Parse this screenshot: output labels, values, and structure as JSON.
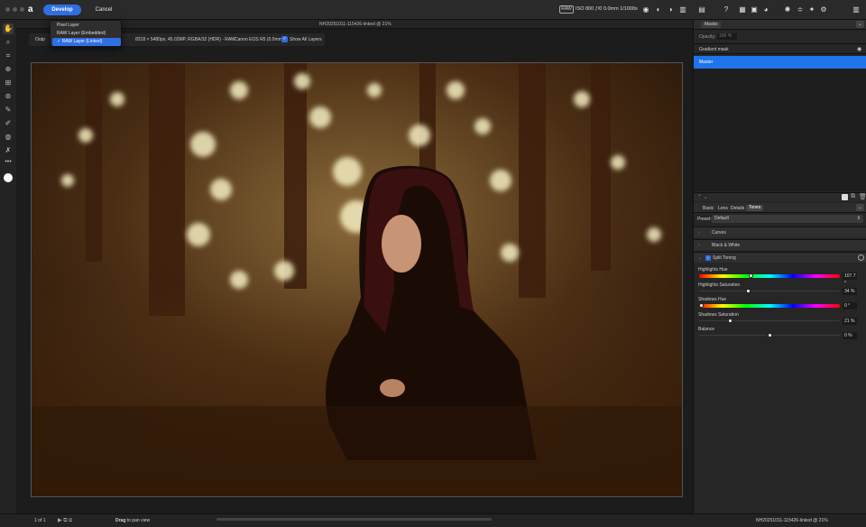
{
  "topbar": {
    "develop_label": "Develop",
    "cancel_label": "Cancel",
    "raw_badge": "RAW",
    "exif": "ISO 800 ƒ/0 0.0mm 1/1000s"
  },
  "document": {
    "title": "NH20251011-115426-linked @ 21%"
  },
  "layer_menu": {
    "items": [
      {
        "label": "Pixel Layer",
        "checked": false,
        "selected": false
      },
      {
        "label": "RAW Layer (Embedded)",
        "checked": false,
        "selected": false
      },
      {
        "label": "RAW Layer (Linked)",
        "checked": true,
        "selected": true
      }
    ]
  },
  "context_bar": {
    "output_label": "Outp",
    "image_info": "8218 × 5480px, 45.02MP, RGBA/32 (HDR) - RAW",
    "camera": "Canon EOS R5 (0.0mm)",
    "show_all_layers": "Show All Layers"
  },
  "masks_panel": {
    "tab": "Masks",
    "opacity_label": "Opacity:",
    "opacity_value": "100 %",
    "items": [
      {
        "label": "Gradient mask",
        "selected": false
      },
      {
        "label": "Master",
        "selected": true
      }
    ]
  },
  "adjust_panel": {
    "tabs": [
      "Basic",
      "Lens",
      "Details",
      "Tones"
    ],
    "active_tab": "Tones",
    "preset_label": "Preset:",
    "preset_value": "Default",
    "sections": {
      "curves": "Curves",
      "bw": "Black & White",
      "split": "Split Toning"
    }
  },
  "split_toning": {
    "highlights_hue": {
      "label": "Highlights Hue",
      "value": "107.7 °",
      "pos": 0.36
    },
    "highlights_saturation": {
      "label": "Highlights Saturation",
      "value": "34 %",
      "pos": 0.34
    },
    "shadows_hue": {
      "label": "Shadows Hue",
      "value": "0 °",
      "pos": 0.0
    },
    "shadows_saturation": {
      "label": "Shadows Saturation",
      "value": "21 %",
      "pos": 0.21
    },
    "balance": {
      "label": "Balance",
      "value": "0 %",
      "pos": 0.5
    }
  },
  "status": {
    "page": "1 of 1",
    "hint_bold": "Drag",
    "hint_rest": "to pan view",
    "doc": "NH20251011-115426-linked @ 21%"
  },
  "colors": {
    "accent": "#2f6fe4",
    "panel": "#262626"
  }
}
